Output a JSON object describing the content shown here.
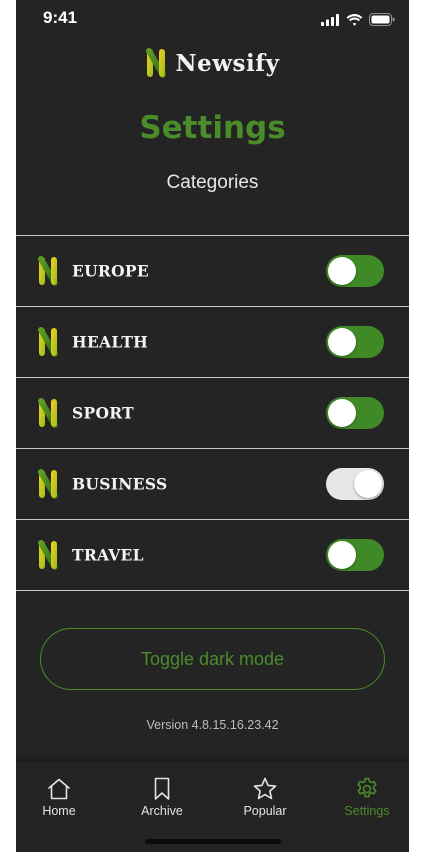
{
  "status_bar": {
    "time": "9:41"
  },
  "brand": {
    "name": "Newsify",
    "logo_icon": "newsify-n-logo"
  },
  "header": {
    "title": "Settings",
    "subtitle": "Categories"
  },
  "colors": {
    "accent": "#4a8c2a",
    "background": "#242424",
    "toggle_on": "#3f8a26",
    "toggle_off": "#e6e6e6"
  },
  "categories": [
    {
      "label": "EUROPE",
      "enabled": true
    },
    {
      "label": "HEALTH",
      "enabled": true
    },
    {
      "label": "SPORT",
      "enabled": true
    },
    {
      "label": "BUSINESS",
      "enabled": false
    },
    {
      "label": "TRAVEL",
      "enabled": true
    }
  ],
  "actions": {
    "toggle_dark_mode_label": "Toggle dark mode"
  },
  "footer": {
    "version": "Version 4.8.15.16.23.42"
  },
  "tabs": [
    {
      "label": "Home",
      "icon": "home-icon",
      "active": false
    },
    {
      "label": "Archive",
      "icon": "bookmark-icon",
      "active": false
    },
    {
      "label": "Popular",
      "icon": "star-icon",
      "active": false
    },
    {
      "label": "Settings",
      "icon": "gear-icon",
      "active": true
    }
  ]
}
